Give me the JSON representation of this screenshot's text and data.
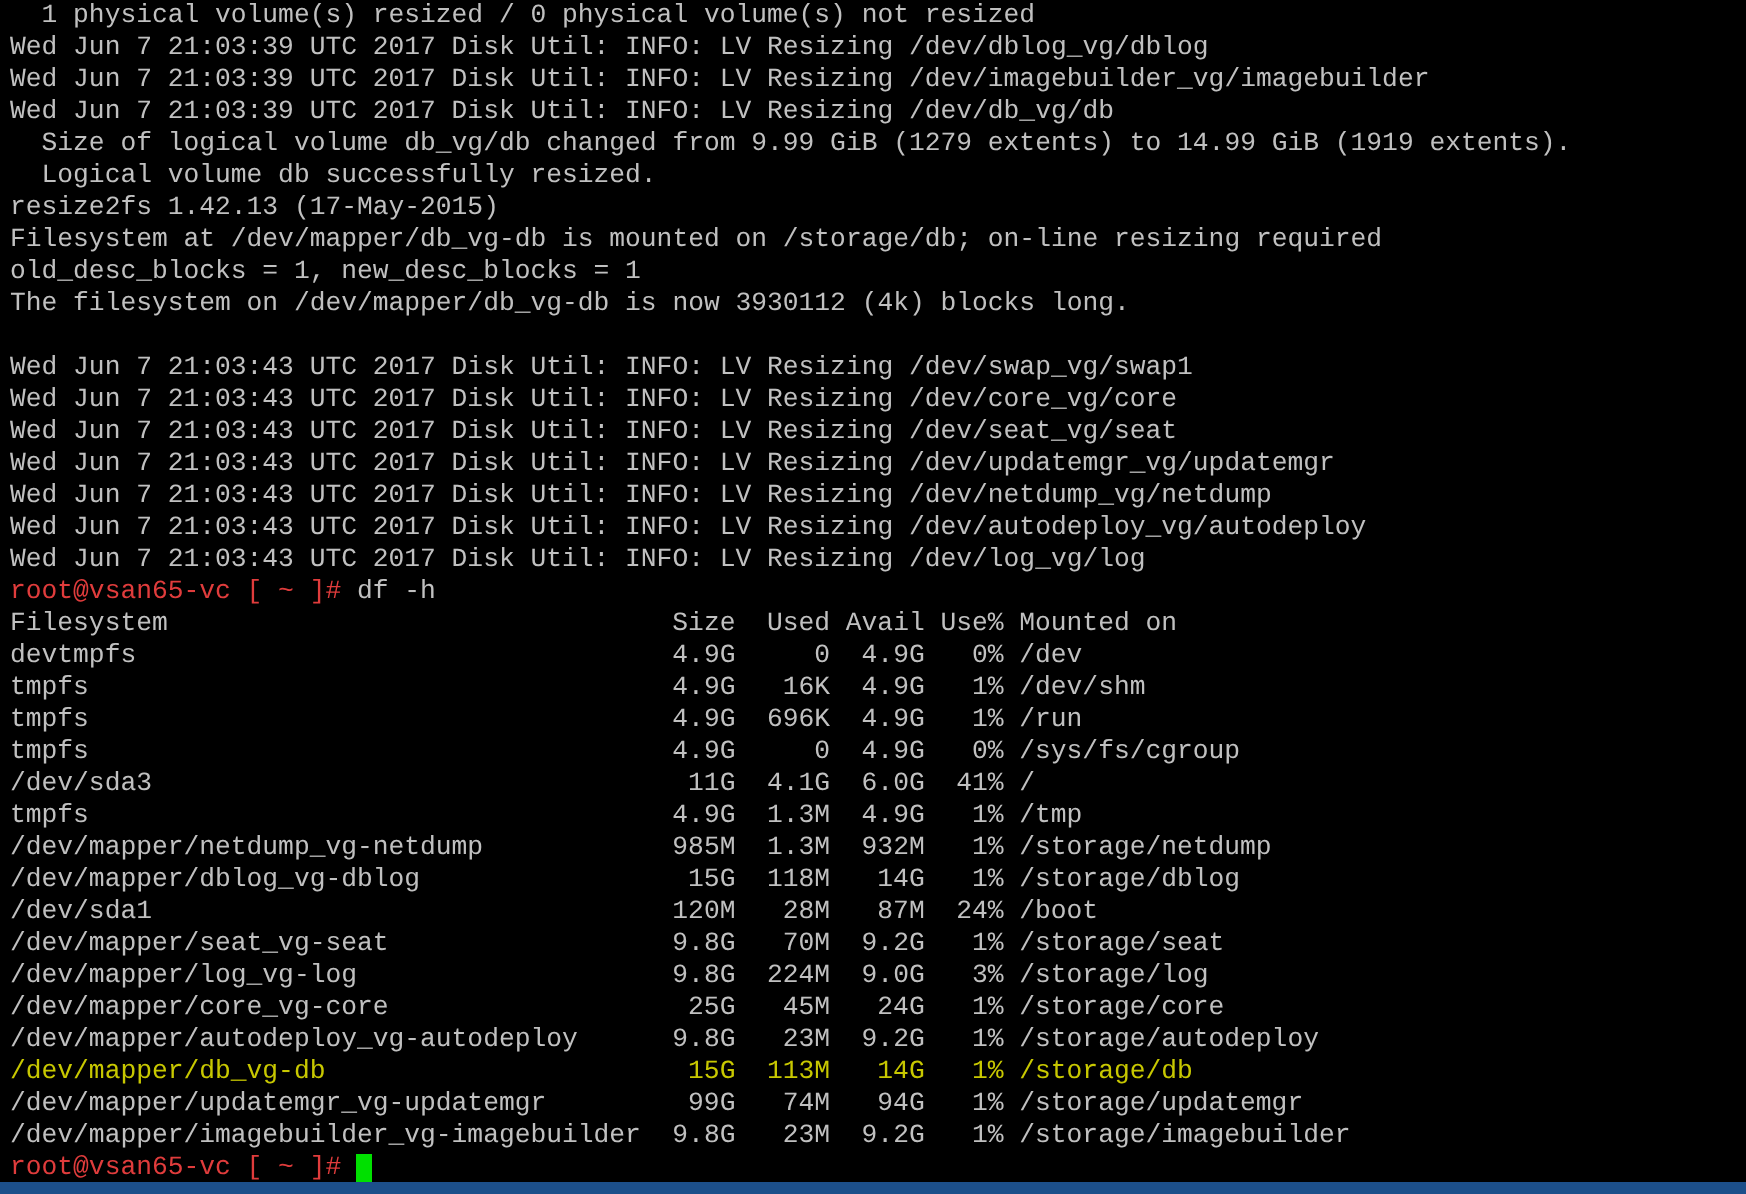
{
  "terminal": {
    "lines": [
      {
        "kind": "output",
        "text": "  1 physical volume(s) resized / 0 physical volume(s) not resized"
      },
      {
        "kind": "output",
        "text": "Wed Jun 7 21:03:39 UTC 2017 Disk Util: INFO: LV Resizing /dev/dblog_vg/dblog"
      },
      {
        "kind": "output",
        "text": "Wed Jun 7 21:03:39 UTC 2017 Disk Util: INFO: LV Resizing /dev/imagebuilder_vg/imagebuilder"
      },
      {
        "kind": "output",
        "text": "Wed Jun 7 21:03:39 UTC 2017 Disk Util: INFO: LV Resizing /dev/db_vg/db"
      },
      {
        "kind": "output",
        "text": "  Size of logical volume db_vg/db changed from 9.99 GiB (1279 extents) to 14.99 GiB (1919 extents)."
      },
      {
        "kind": "output",
        "text": "  Logical volume db successfully resized."
      },
      {
        "kind": "output",
        "text": "resize2fs 1.42.13 (17-May-2015)"
      },
      {
        "kind": "output",
        "text": "Filesystem at /dev/mapper/db_vg-db is mounted on /storage/db; on-line resizing required"
      },
      {
        "kind": "output",
        "text": "old_desc_blocks = 1, new_desc_blocks = 1"
      },
      {
        "kind": "output",
        "text": "The filesystem on /dev/mapper/db_vg-db is now 3930112 (4k) blocks long."
      },
      {
        "kind": "blank"
      },
      {
        "kind": "output",
        "text": "Wed Jun 7 21:03:43 UTC 2017 Disk Util: INFO: LV Resizing /dev/swap_vg/swap1"
      },
      {
        "kind": "output",
        "text": "Wed Jun 7 21:03:43 UTC 2017 Disk Util: INFO: LV Resizing /dev/core_vg/core"
      },
      {
        "kind": "output",
        "text": "Wed Jun 7 21:03:43 UTC 2017 Disk Util: INFO: LV Resizing /dev/seat_vg/seat"
      },
      {
        "kind": "output",
        "text": "Wed Jun 7 21:03:43 UTC 2017 Disk Util: INFO: LV Resizing /dev/updatemgr_vg/updatemgr"
      },
      {
        "kind": "output",
        "text": "Wed Jun 7 21:03:43 UTC 2017 Disk Util: INFO: LV Resizing /dev/netdump_vg/netdump"
      },
      {
        "kind": "output",
        "text": "Wed Jun 7 21:03:43 UTC 2017 Disk Util: INFO: LV Resizing /dev/autodeploy_vg/autodeploy"
      },
      {
        "kind": "output",
        "text": "Wed Jun 7 21:03:43 UTC 2017 Disk Util: INFO: LV Resizing /dev/log_vg/log"
      },
      {
        "kind": "prompt",
        "prompt": "root@vsan65-vc [ ~ ]#",
        "command": "df -h"
      }
    ],
    "df_table": {
      "columns": [
        "Filesystem",
        "Size",
        "Used",
        "Avail",
        "Use%",
        "Mounted on"
      ],
      "rows": [
        {
          "cells": [
            "devtmpfs",
            "4.9G",
            "0",
            "4.9G",
            "0%",
            "/dev"
          ],
          "highlighted": false
        },
        {
          "cells": [
            "tmpfs",
            "4.9G",
            "16K",
            "4.9G",
            "1%",
            "/dev/shm"
          ],
          "highlighted": false
        },
        {
          "cells": [
            "tmpfs",
            "4.9G",
            "696K",
            "4.9G",
            "1%",
            "/run"
          ],
          "highlighted": false
        },
        {
          "cells": [
            "tmpfs",
            "4.9G",
            "0",
            "4.9G",
            "0%",
            "/sys/fs/cgroup"
          ],
          "highlighted": false
        },
        {
          "cells": [
            "/dev/sda3",
            "11G",
            "4.1G",
            "6.0G",
            "41%",
            "/"
          ],
          "highlighted": false
        },
        {
          "cells": [
            "tmpfs",
            "4.9G",
            "1.3M",
            "4.9G",
            "1%",
            "/tmp"
          ],
          "highlighted": false
        },
        {
          "cells": [
            "/dev/mapper/netdump_vg-netdump",
            "985M",
            "1.3M",
            "932M",
            "1%",
            "/storage/netdump"
          ],
          "highlighted": false
        },
        {
          "cells": [
            "/dev/mapper/dblog_vg-dblog",
            "15G",
            "118M",
            "14G",
            "1%",
            "/storage/dblog"
          ],
          "highlighted": false
        },
        {
          "cells": [
            "/dev/sda1",
            "120M",
            "28M",
            "87M",
            "24%",
            "/boot"
          ],
          "highlighted": false
        },
        {
          "cells": [
            "/dev/mapper/seat_vg-seat",
            "9.8G",
            "70M",
            "9.2G",
            "1%",
            "/storage/seat"
          ],
          "highlighted": false
        },
        {
          "cells": [
            "/dev/mapper/log_vg-log",
            "9.8G",
            "224M",
            "9.0G",
            "3%",
            "/storage/log"
          ],
          "highlighted": false
        },
        {
          "cells": [
            "/dev/mapper/core_vg-core",
            "25G",
            "45M",
            "24G",
            "1%",
            "/storage/core"
          ],
          "highlighted": false
        },
        {
          "cells": [
            "/dev/mapper/autodeploy_vg-autodeploy",
            "9.8G",
            "23M",
            "9.2G",
            "1%",
            "/storage/autodeploy"
          ],
          "highlighted": false
        },
        {
          "cells": [
            "/dev/mapper/db_vg-db",
            "15G",
            "113M",
            "14G",
            "1%",
            "/storage/db"
          ],
          "highlighted": true
        },
        {
          "cells": [
            "/dev/mapper/updatemgr_vg-updatemgr",
            "99G",
            "74M",
            "94G",
            "1%",
            "/storage/updatemgr"
          ],
          "highlighted": false
        },
        {
          "cells": [
            "/dev/mapper/imagebuilder_vg-imagebuilder",
            "9.8G",
            "23M",
            "9.2G",
            "1%",
            "/storage/imagebuilder"
          ],
          "highlighted": false
        }
      ]
    },
    "final_prompt": {
      "prompt": "root@vsan65-vc [ ~ ]#",
      "cursor": true
    }
  }
}
